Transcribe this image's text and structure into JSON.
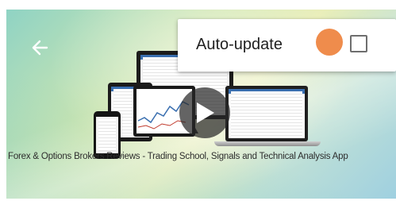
{
  "video": {
    "caption": "Forex & Options Brokers Reviews - Trading School, Signals and Technical Analysis App"
  },
  "menu": {
    "items": [
      {
        "label": "Auto-update",
        "checked": false
      }
    ]
  },
  "colors": {
    "touch_indicator": "#ef8c4c",
    "checkbox_border": "#6e6e6e",
    "menu_text": "#212121"
  },
  "icons": {
    "back": "back-arrow-icon",
    "play": "play-icon"
  }
}
